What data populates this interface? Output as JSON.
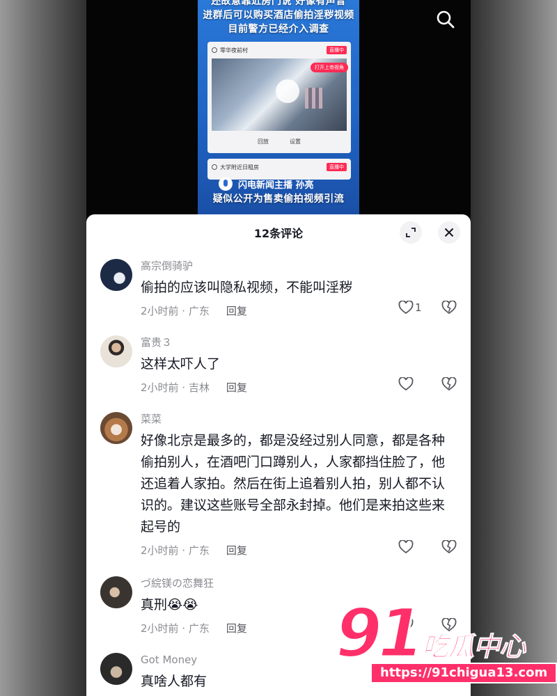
{
  "video": {
    "caption_lines": [
      "还故意靠近房门说 好像有声音",
      "进群后可以购买酒店偷拍淫秽视频",
      "目前警方已经介入调查"
    ],
    "card1": {
      "channel": "零华夜前村",
      "live_badge": "直播中",
      "overlay_pill": "打开上帝视角",
      "footer_left": "回放",
      "footer_right": "设置"
    },
    "card2": {
      "channel": "大学附近日租房",
      "live_badge": "直播中"
    },
    "anchor_name": "闪电新闻主播 孙亮",
    "bottom_caption": "疑似公开为售卖偷拍视频引流"
  },
  "sheet": {
    "title": "12条评论"
  },
  "comments": [
    {
      "user": "高宗倒骑驴",
      "text": "偷拍的应该叫隐私视频，不能叫淫秽",
      "meta": "2小时前 · 广东",
      "reply": "回复",
      "likes": "1"
    },
    {
      "user": "富贵３",
      "text": "这样太吓人了",
      "meta": "2小时前 · 吉林",
      "reply": "回复",
      "likes": ""
    },
    {
      "user": "菜菜",
      "text": "好像北京是最多的，都是没经过别人同意，都是各种偷拍别人，在酒吧门口蹲别人，人家都挡住脸了，他还追着人家拍。然后在街上追着别人拍，别人都不认识的。建议这些账号全部永封掉。他们是来拍这些来起号的",
      "meta": "2小时前 · 广东",
      "reply": "回复",
      "likes": ""
    },
    {
      "user": "づ綄镁の恋舞狂",
      "text": "真刑😭😭",
      "meta": "2小时前 · 广东",
      "reply": "回复",
      "likes": ""
    },
    {
      "user": "Got Money",
      "text": "真啥人都有",
      "meta": "",
      "reply": "",
      "likes": ""
    }
  ],
  "watermark": {
    "number": "91",
    "name": "吃瓜中心",
    "url": "https://91chigua13.com"
  },
  "colors": {
    "accent": "#fe2c55",
    "watermark": "#ff2f6a",
    "poster_blue": "#2a78d8"
  },
  "icons": [
    "search-icon",
    "expand-icon",
    "close-icon",
    "heart-icon",
    "broken-heart-icon",
    "mic-icon"
  ]
}
